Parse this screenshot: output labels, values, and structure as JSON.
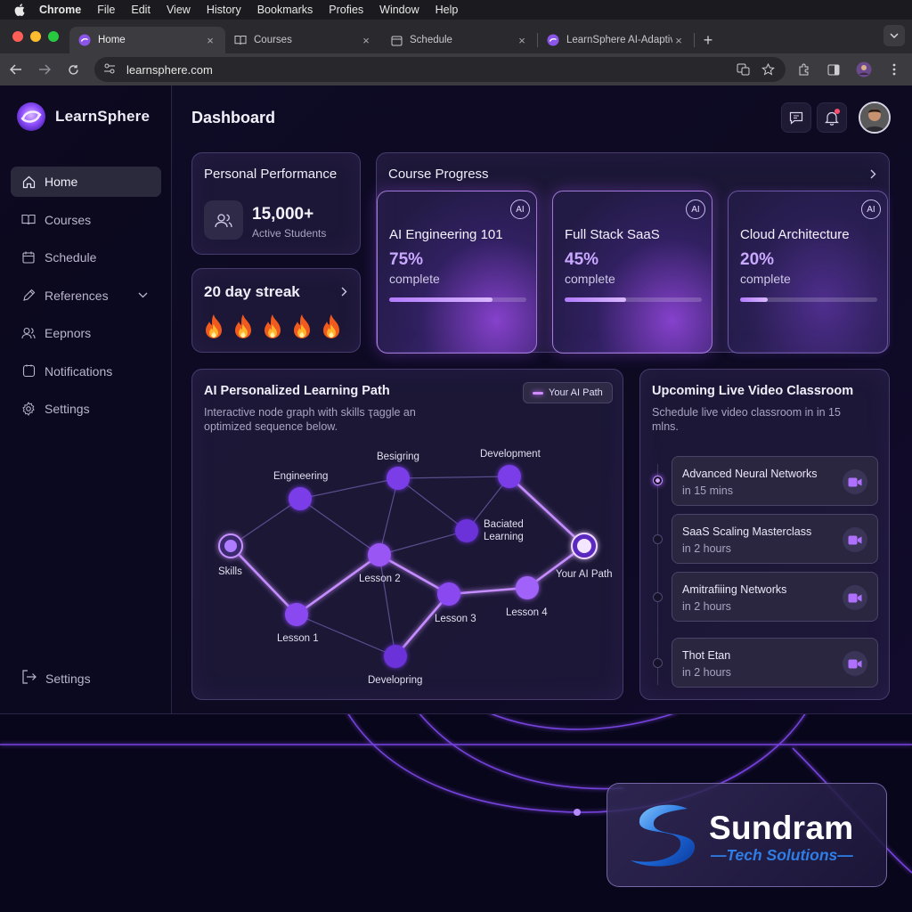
{
  "menubar": {
    "items": [
      "Chrome",
      "File",
      "Edit",
      "View",
      "History",
      "Bookmarks",
      "Profies",
      "Window",
      "Help"
    ]
  },
  "browser": {
    "tabs": [
      {
        "label": "Home",
        "active": true
      },
      {
        "label": "Courses",
        "active": false
      },
      {
        "label": "Schedule",
        "active": false
      },
      {
        "label": "LearnSphere AI-Adaptive",
        "active": false
      }
    ],
    "url": "learnsphere.com"
  },
  "app": {
    "brand": "LearnSphere",
    "page_title": "Dashboard",
    "sidebar": {
      "items": [
        {
          "label": "Home",
          "icon": "home-icon",
          "active": true
        },
        {
          "label": "Courses",
          "icon": "book-icon"
        },
        {
          "label": "Schedule",
          "icon": "calendar-icon"
        },
        {
          "label": "References",
          "icon": "pen-icon",
          "has_chevron": true
        },
        {
          "label": "Eepnors",
          "icon": "users-icon"
        },
        {
          "label": "Notifications",
          "icon": "bell-square-icon"
        },
        {
          "label": "Settings",
          "icon": "gear-icon"
        }
      ],
      "bottom_label": "Settings"
    },
    "performance": {
      "title": "Personal Performance",
      "value": "15,000+",
      "label": "Active Students"
    },
    "streak": {
      "title": "20 day streak",
      "flames": 5
    },
    "course_progress": {
      "title": "Course Progress",
      "badge": "AI",
      "courses": [
        {
          "name": "AI Engineering 101",
          "percent_label": "75%",
          "word": "complete",
          "progress": 0.75
        },
        {
          "name": "Full Stack SaaS",
          "percent_label": "45%",
          "word": "complete",
          "progress": 0.45
        },
        {
          "name": "Cloud Architecture",
          "percent_label": "20%",
          "word": "complete",
          "progress": 0.2
        }
      ]
    },
    "learning_path": {
      "title": "AI Personalized Learning Path",
      "description": "Interactive node graph with skills  ҭaggle an optimized sequence below.",
      "badge": "Your AI Path",
      "nodes": [
        "Engineering",
        "Besigring",
        "Development",
        "Baciated Learning",
        "Skills",
        "Lesson 2",
        "Your AI Path",
        "Lesson 1",
        "Lesson 3",
        "Lesson 4",
        "Developring"
      ]
    },
    "live_classroom": {
      "title": "Upcoming Live Video Classroom",
      "description": "Schedule live video classroom in in 15 mlns.",
      "sessions": [
        {
          "name": "Advanced Neural Networks",
          "time": "in 15 mins",
          "active": true
        },
        {
          "name": "SaaS Scaling Masterclass",
          "time": "in 2 hours",
          "active": false
        },
        {
          "name": "Amitrafiiing Networks",
          "time": "in 2 hours",
          "active": false
        },
        {
          "name": "Thot Etan",
          "time": "in 2 hours",
          "active": false
        }
      ]
    }
  },
  "watermark": {
    "name": "Sundram",
    "subtitle": "—Tech Solutions—"
  },
  "colors": {
    "accent": "#a66bff",
    "background": "#08061a",
    "watermark_blue": "#2f7de6"
  }
}
